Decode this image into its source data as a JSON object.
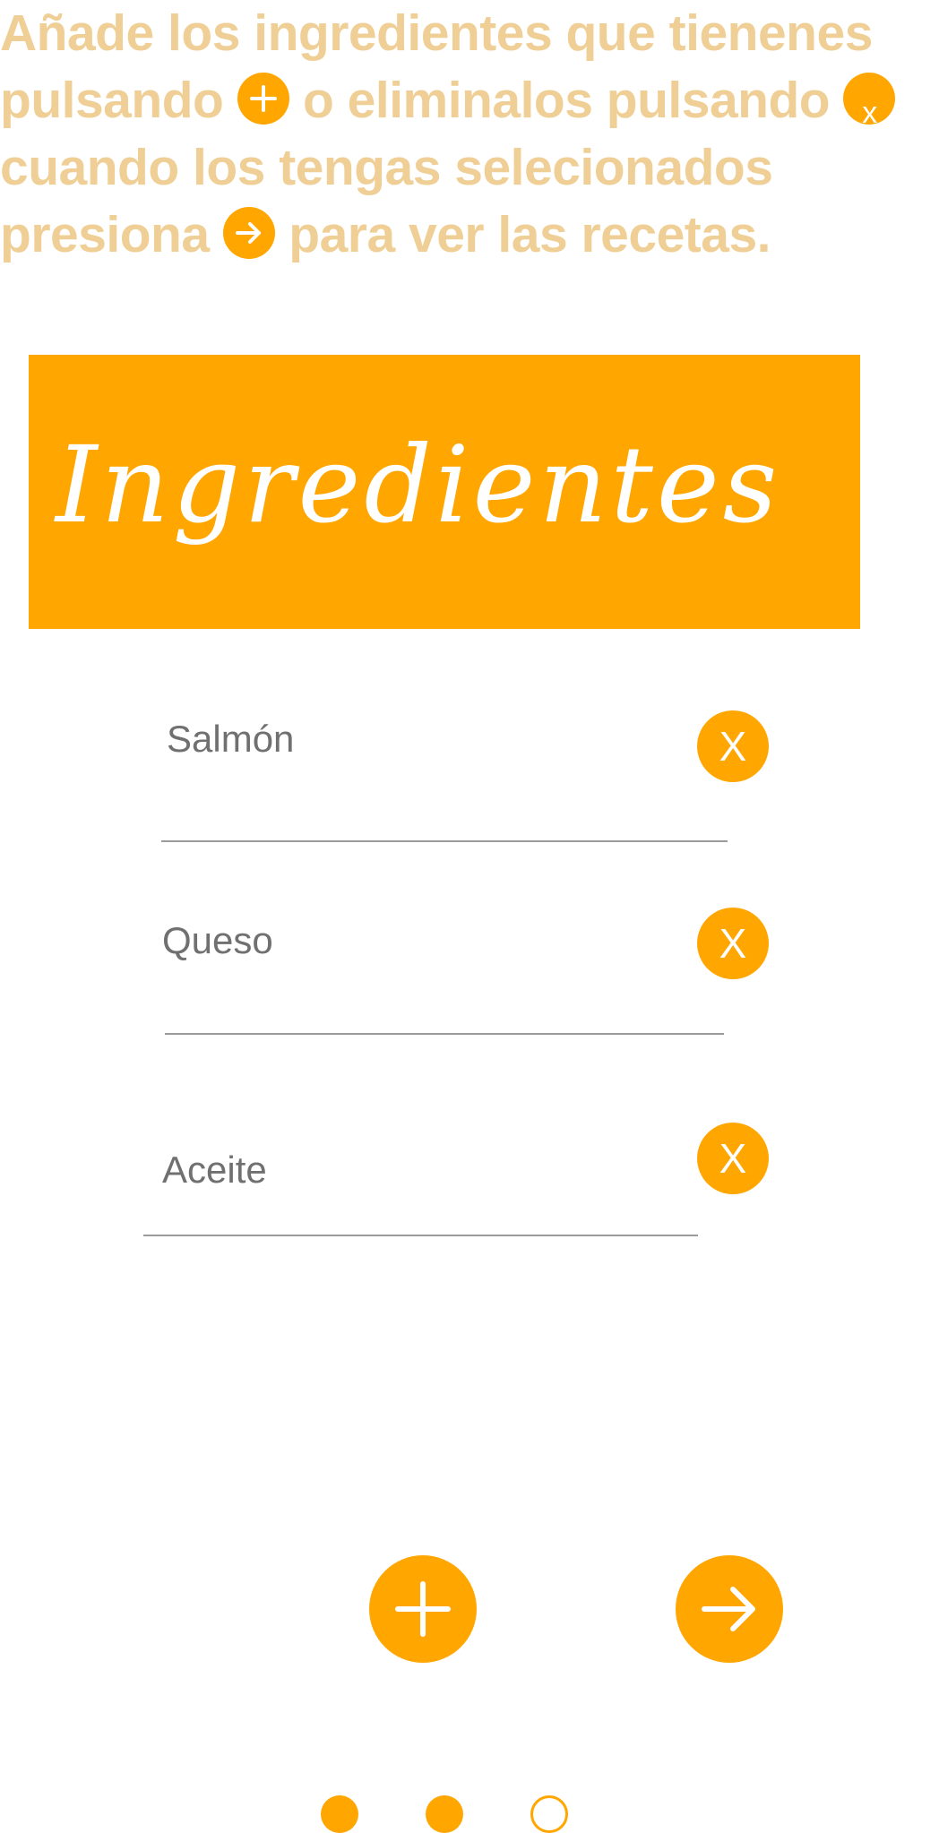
{
  "colors": {
    "accent": "#ffa600",
    "instruction_text": "#efcf95",
    "ingredient_text": "#707070",
    "divider": "#9a9a9a"
  },
  "instructions": {
    "line1": "Añade los ingredientes que tienenes",
    "line2_pre": "pulsando",
    "line2_mid": "o eliminalos pulsando",
    "line2_icon_x": "x",
    "line3": "cuando los tengas selecionados",
    "line4_pre": "presiona",
    "line4_post": "para ver las recetas.",
    "icons": [
      "plus-icon",
      "close-icon",
      "arrow-right-icon"
    ]
  },
  "banner": {
    "title": "Ingredientes"
  },
  "ingredients": [
    {
      "name": "Salmón",
      "remove_label": "X"
    },
    {
      "name": "Queso",
      "remove_label": "X"
    },
    {
      "name": "Aceite",
      "remove_label": "X"
    }
  ],
  "actions": {
    "add_icon": "plus-icon",
    "next_icon": "arrow-right-icon"
  },
  "pagination": {
    "total": 3,
    "current": 3,
    "states": [
      "filled",
      "filled",
      "empty"
    ]
  }
}
